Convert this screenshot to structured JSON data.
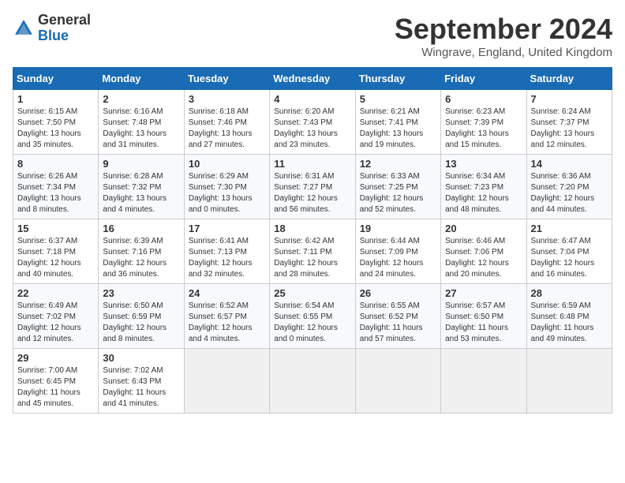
{
  "header": {
    "logo_line1": "General",
    "logo_line2": "Blue",
    "month_title": "September 2024",
    "location": "Wingrave, England, United Kingdom"
  },
  "weekdays": [
    "Sunday",
    "Monday",
    "Tuesday",
    "Wednesday",
    "Thursday",
    "Friday",
    "Saturday"
  ],
  "weeks": [
    [
      {
        "day": "1",
        "sunrise": "Sunrise: 6:15 AM",
        "sunset": "Sunset: 7:50 PM",
        "daylight": "Daylight: 13 hours and 35 minutes."
      },
      {
        "day": "2",
        "sunrise": "Sunrise: 6:16 AM",
        "sunset": "Sunset: 7:48 PM",
        "daylight": "Daylight: 13 hours and 31 minutes."
      },
      {
        "day": "3",
        "sunrise": "Sunrise: 6:18 AM",
        "sunset": "Sunset: 7:46 PM",
        "daylight": "Daylight: 13 hours and 27 minutes."
      },
      {
        "day": "4",
        "sunrise": "Sunrise: 6:20 AM",
        "sunset": "Sunset: 7:43 PM",
        "daylight": "Daylight: 13 hours and 23 minutes."
      },
      {
        "day": "5",
        "sunrise": "Sunrise: 6:21 AM",
        "sunset": "Sunset: 7:41 PM",
        "daylight": "Daylight: 13 hours and 19 minutes."
      },
      {
        "day": "6",
        "sunrise": "Sunrise: 6:23 AM",
        "sunset": "Sunset: 7:39 PM",
        "daylight": "Daylight: 13 hours and 15 minutes."
      },
      {
        "day": "7",
        "sunrise": "Sunrise: 6:24 AM",
        "sunset": "Sunset: 7:37 PM",
        "daylight": "Daylight: 13 hours and 12 minutes."
      }
    ],
    [
      {
        "day": "8",
        "sunrise": "Sunrise: 6:26 AM",
        "sunset": "Sunset: 7:34 PM",
        "daylight": "Daylight: 13 hours and 8 minutes."
      },
      {
        "day": "9",
        "sunrise": "Sunrise: 6:28 AM",
        "sunset": "Sunset: 7:32 PM",
        "daylight": "Daylight: 13 hours and 4 minutes."
      },
      {
        "day": "10",
        "sunrise": "Sunrise: 6:29 AM",
        "sunset": "Sunset: 7:30 PM",
        "daylight": "Daylight: 13 hours and 0 minutes."
      },
      {
        "day": "11",
        "sunrise": "Sunrise: 6:31 AM",
        "sunset": "Sunset: 7:27 PM",
        "daylight": "Daylight: 12 hours and 56 minutes."
      },
      {
        "day": "12",
        "sunrise": "Sunrise: 6:33 AM",
        "sunset": "Sunset: 7:25 PM",
        "daylight": "Daylight: 12 hours and 52 minutes."
      },
      {
        "day": "13",
        "sunrise": "Sunrise: 6:34 AM",
        "sunset": "Sunset: 7:23 PM",
        "daylight": "Daylight: 12 hours and 48 minutes."
      },
      {
        "day": "14",
        "sunrise": "Sunrise: 6:36 AM",
        "sunset": "Sunset: 7:20 PM",
        "daylight": "Daylight: 12 hours and 44 minutes."
      }
    ],
    [
      {
        "day": "15",
        "sunrise": "Sunrise: 6:37 AM",
        "sunset": "Sunset: 7:18 PM",
        "daylight": "Daylight: 12 hours and 40 minutes."
      },
      {
        "day": "16",
        "sunrise": "Sunrise: 6:39 AM",
        "sunset": "Sunset: 7:16 PM",
        "daylight": "Daylight: 12 hours and 36 minutes."
      },
      {
        "day": "17",
        "sunrise": "Sunrise: 6:41 AM",
        "sunset": "Sunset: 7:13 PM",
        "daylight": "Daylight: 12 hours and 32 minutes."
      },
      {
        "day": "18",
        "sunrise": "Sunrise: 6:42 AM",
        "sunset": "Sunset: 7:11 PM",
        "daylight": "Daylight: 12 hours and 28 minutes."
      },
      {
        "day": "19",
        "sunrise": "Sunrise: 6:44 AM",
        "sunset": "Sunset: 7:09 PM",
        "daylight": "Daylight: 12 hours and 24 minutes."
      },
      {
        "day": "20",
        "sunrise": "Sunrise: 6:46 AM",
        "sunset": "Sunset: 7:06 PM",
        "daylight": "Daylight: 12 hours and 20 minutes."
      },
      {
        "day": "21",
        "sunrise": "Sunrise: 6:47 AM",
        "sunset": "Sunset: 7:04 PM",
        "daylight": "Daylight: 12 hours and 16 minutes."
      }
    ],
    [
      {
        "day": "22",
        "sunrise": "Sunrise: 6:49 AM",
        "sunset": "Sunset: 7:02 PM",
        "daylight": "Daylight: 12 hours and 12 minutes."
      },
      {
        "day": "23",
        "sunrise": "Sunrise: 6:50 AM",
        "sunset": "Sunset: 6:59 PM",
        "daylight": "Daylight: 12 hours and 8 minutes."
      },
      {
        "day": "24",
        "sunrise": "Sunrise: 6:52 AM",
        "sunset": "Sunset: 6:57 PM",
        "daylight": "Daylight: 12 hours and 4 minutes."
      },
      {
        "day": "25",
        "sunrise": "Sunrise: 6:54 AM",
        "sunset": "Sunset: 6:55 PM",
        "daylight": "Daylight: 12 hours and 0 minutes."
      },
      {
        "day": "26",
        "sunrise": "Sunrise: 6:55 AM",
        "sunset": "Sunset: 6:52 PM",
        "daylight": "Daylight: 11 hours and 57 minutes."
      },
      {
        "day": "27",
        "sunrise": "Sunrise: 6:57 AM",
        "sunset": "Sunset: 6:50 PM",
        "daylight": "Daylight: 11 hours and 53 minutes."
      },
      {
        "day": "28",
        "sunrise": "Sunrise: 6:59 AM",
        "sunset": "Sunset: 6:48 PM",
        "daylight": "Daylight: 11 hours and 49 minutes."
      }
    ],
    [
      {
        "day": "29",
        "sunrise": "Sunrise: 7:00 AM",
        "sunset": "Sunset: 6:45 PM",
        "daylight": "Daylight: 11 hours and 45 minutes."
      },
      {
        "day": "30",
        "sunrise": "Sunrise: 7:02 AM",
        "sunset": "Sunset: 6:43 PM",
        "daylight": "Daylight: 11 hours and 41 minutes."
      },
      null,
      null,
      null,
      null,
      null
    ]
  ]
}
